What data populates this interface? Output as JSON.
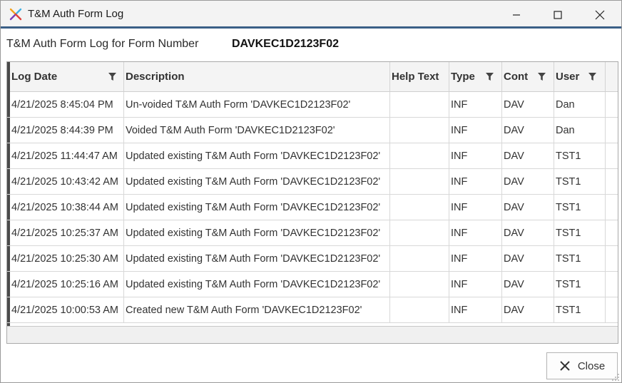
{
  "window": {
    "title": "T&M Auth Form Log"
  },
  "form": {
    "label": "T&M Auth Form Log for Form Number",
    "number": "DAVKEC1D2123F02"
  },
  "grid": {
    "columns": [
      {
        "key": "log_date",
        "label": "Log Date",
        "filter": true
      },
      {
        "key": "description",
        "label": "Description",
        "filter": false
      },
      {
        "key": "help_text",
        "label": "Help Text",
        "filter": false
      },
      {
        "key": "type",
        "label": "Type",
        "filter": true
      },
      {
        "key": "cont",
        "label": "Cont",
        "filter": true
      },
      {
        "key": "user",
        "label": "User",
        "filter": true
      }
    ],
    "rows": [
      {
        "log_date": "4/21/2025 8:45:04 PM",
        "description": "Un-voided T&M Auth Form 'DAVKEC1D2123F02'",
        "help_text": "",
        "type": "INF",
        "cont": "DAV",
        "user": "Dan"
      },
      {
        "log_date": "4/21/2025 8:44:39 PM",
        "description": "Voided T&M Auth Form 'DAVKEC1D2123F02'",
        "help_text": "",
        "type": "INF",
        "cont": "DAV",
        "user": "Dan"
      },
      {
        "log_date": "4/21/2025 11:44:47 AM",
        "description": "Updated existing T&M Auth Form 'DAVKEC1D2123F02'",
        "help_text": "",
        "type": "INF",
        "cont": "DAV",
        "user": "TST1"
      },
      {
        "log_date": "4/21/2025 10:43:42 AM",
        "description": "Updated existing T&M Auth Form 'DAVKEC1D2123F02'",
        "help_text": "",
        "type": "INF",
        "cont": "DAV",
        "user": "TST1"
      },
      {
        "log_date": "4/21/2025 10:38:44 AM",
        "description": "Updated existing T&M Auth Form 'DAVKEC1D2123F02'",
        "help_text": "",
        "type": "INF",
        "cont": "DAV",
        "user": "TST1"
      },
      {
        "log_date": "4/21/2025 10:25:37 AM",
        "description": "Updated existing T&M Auth Form 'DAVKEC1D2123F02'",
        "help_text": "",
        "type": "INF",
        "cont": "DAV",
        "user": "TST1"
      },
      {
        "log_date": "4/21/2025 10:25:30 AM",
        "description": "Updated existing T&M Auth Form 'DAVKEC1D2123F02'",
        "help_text": "",
        "type": "INF",
        "cont": "DAV",
        "user": "TST1"
      },
      {
        "log_date": "4/21/2025 10:25:16 AM",
        "description": "Updated existing T&M Auth Form 'DAVKEC1D2123F02'",
        "help_text": "",
        "type": "INF",
        "cont": "DAV",
        "user": "TST1"
      },
      {
        "log_date": "4/21/2025 10:00:53 AM",
        "description": "Created new T&M Auth Form 'DAVKEC1D2123F02'",
        "help_text": "",
        "type": "INF",
        "cont": "DAV",
        "user": "TST1"
      }
    ]
  },
  "buttons": {
    "close_label": "Close"
  },
  "icons": {
    "app": "app-logo-icon",
    "minimize": "minimize-icon",
    "maximize": "maximize-icon",
    "close": "close-icon",
    "filter": "filter-icon",
    "resize_grip": "resize-grip-icon"
  },
  "colors": {
    "title_accent": "#3a5f86",
    "row_indicator": "#4a4a4a"
  }
}
